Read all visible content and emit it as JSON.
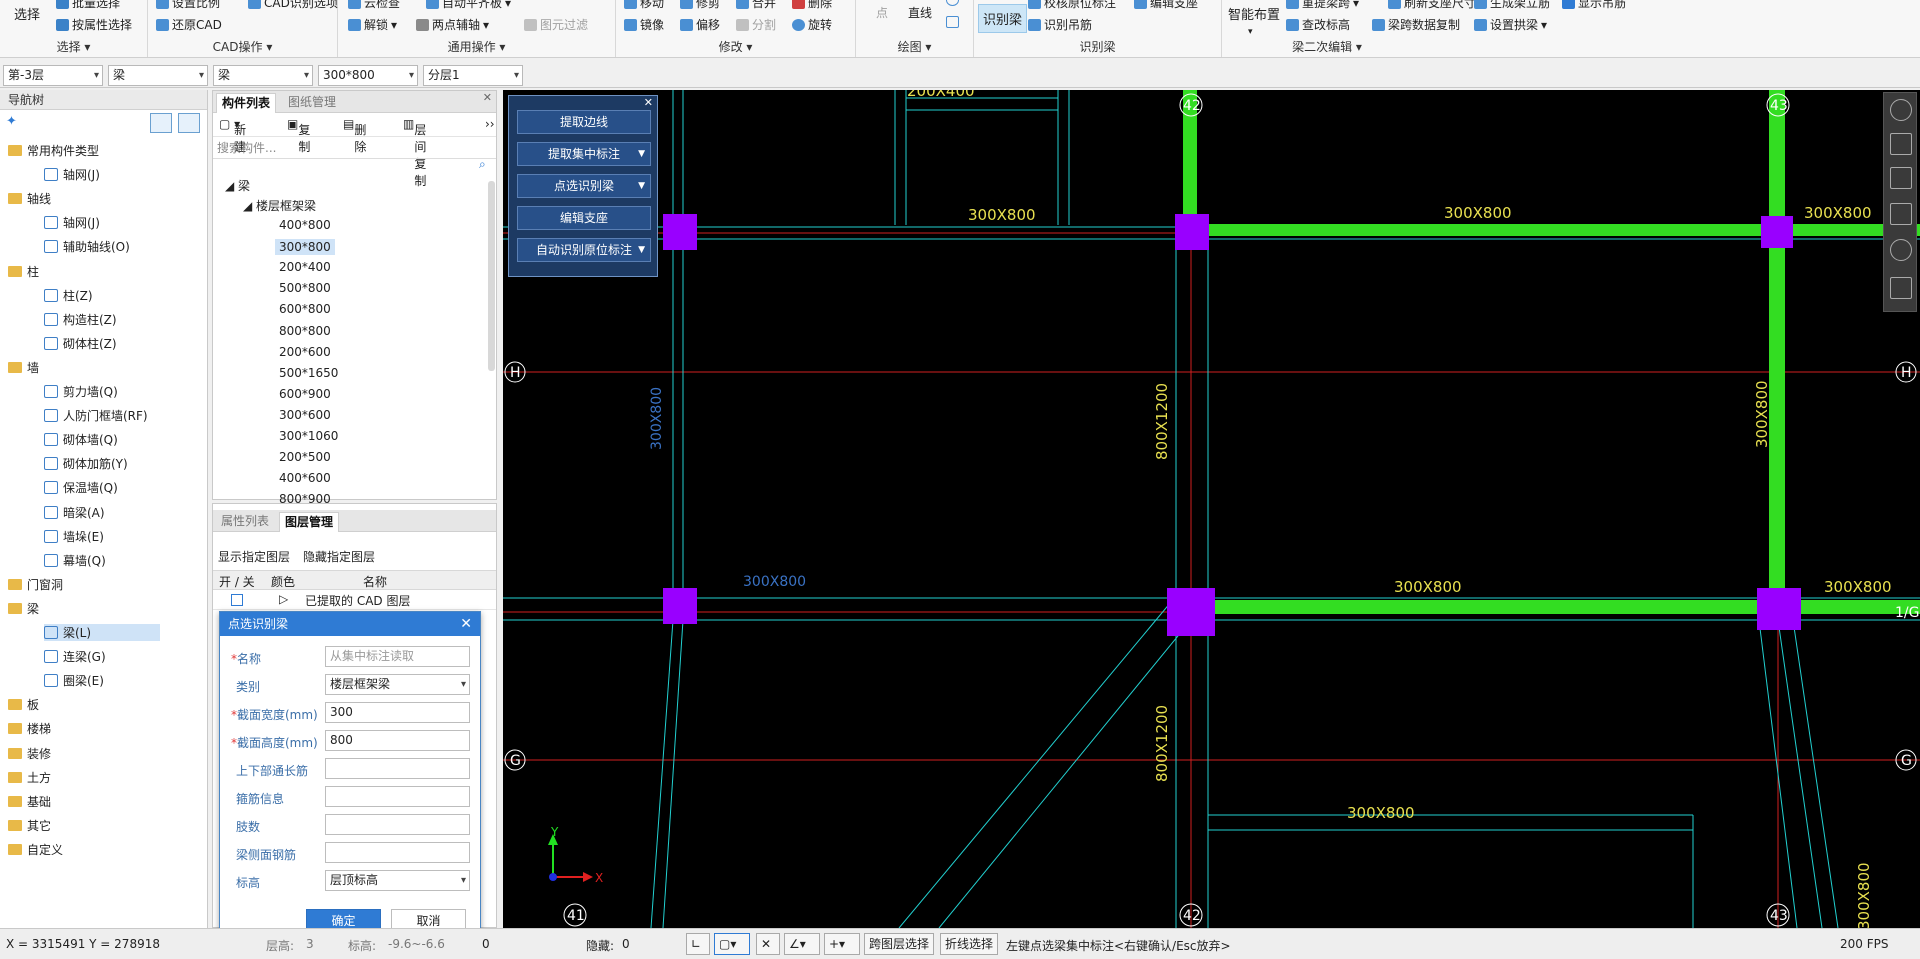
{
  "ribbon": {
    "groups": [
      {
        "id": "select",
        "title": "选择",
        "items": [
          "选择",
          "批量选择",
          "按属性选择"
        ]
      },
      {
        "id": "cad",
        "title": "CAD操作",
        "items": [
          "设置比例",
          "CAD识别选项",
          "还原CAD"
        ]
      },
      {
        "id": "common",
        "title": "通用操作",
        "items": [
          "云检查",
          "自动平齐板",
          "解锁",
          "两点辅轴",
          "图元过滤"
        ]
      },
      {
        "id": "modify",
        "title": "修改",
        "items": [
          "移动",
          "修剪",
          "合并",
          "删除",
          "镜像",
          "偏移",
          "分割",
          "旋转"
        ]
      },
      {
        "id": "draw",
        "title": "绘图",
        "items": [
          "点",
          "直线"
        ]
      },
      {
        "id": "recog",
        "title": "识别梁",
        "items": [
          "识别梁",
          "校核原位标注",
          "编辑支座",
          "识别吊筋"
        ]
      },
      {
        "id": "beam2",
        "title": "梁二次编辑",
        "items": [
          "智能布置",
          "重提梁跨",
          "刷新支座尺寸",
          "生成架立筋",
          "显示吊筋",
          "查改标高",
          "梁跨数据复制",
          "设置拱梁"
        ]
      }
    ]
  },
  "selectors": {
    "floor": "第-3层",
    "type": "梁",
    "subtype": "梁",
    "size": "300*800",
    "layer": "分层1"
  },
  "nav": {
    "title": "导航树",
    "tree": [
      {
        "label": "常用构件类型",
        "kind": "folder"
      },
      {
        "label": "轴网(J)",
        "kind": "leaf"
      },
      {
        "label": "轴线",
        "kind": "folder"
      },
      {
        "label": "轴网(J)",
        "kind": "leaf"
      },
      {
        "label": "辅助轴线(O)",
        "kind": "leaf"
      },
      {
        "label": "柱",
        "kind": "folder"
      },
      {
        "label": "柱(Z)",
        "kind": "leaf"
      },
      {
        "label": "构造柱(Z)",
        "kind": "leaf"
      },
      {
        "label": "砌体柱(Z)",
        "kind": "leaf"
      },
      {
        "label": "墙",
        "kind": "folder"
      },
      {
        "label": "剪力墙(Q)",
        "kind": "leaf"
      },
      {
        "label": "人防门框墙(RF)",
        "kind": "leaf"
      },
      {
        "label": "砌体墙(Q)",
        "kind": "leaf"
      },
      {
        "label": "砌体加筋(Y)",
        "kind": "leaf"
      },
      {
        "label": "保温墙(Q)",
        "kind": "leaf"
      },
      {
        "label": "暗梁(A)",
        "kind": "leaf"
      },
      {
        "label": "墙垛(E)",
        "kind": "leaf"
      },
      {
        "label": "幕墙(Q)",
        "kind": "leaf"
      },
      {
        "label": "门窗洞",
        "kind": "folder"
      },
      {
        "label": "梁",
        "kind": "folder"
      },
      {
        "label": "梁(L)",
        "kind": "leaf",
        "selected": true
      },
      {
        "label": "连梁(G)",
        "kind": "leaf"
      },
      {
        "label": "圈梁(E)",
        "kind": "leaf"
      },
      {
        "label": "板",
        "kind": "folder"
      },
      {
        "label": "楼梯",
        "kind": "folder"
      },
      {
        "label": "装修",
        "kind": "folder"
      },
      {
        "label": "土方",
        "kind": "folder"
      },
      {
        "label": "基础",
        "kind": "folder"
      },
      {
        "label": "其它",
        "kind": "folder"
      },
      {
        "label": "自定义",
        "kind": "folder"
      }
    ]
  },
  "complist": {
    "tabs": [
      "构件列表",
      "图纸管理"
    ],
    "tools": [
      "新建",
      "复制",
      "删除",
      "层间复制"
    ],
    "search_placeholder": "搜索构件...",
    "root": "梁",
    "group": "楼层框架梁",
    "items": [
      "400*800",
      "300*800",
      "200*400",
      "500*800",
      "600*800",
      "800*800",
      "200*600",
      "500*1650",
      "600*900",
      "300*600",
      "300*1060",
      "200*500",
      "400*600",
      "800*900"
    ],
    "selected": "300*800"
  },
  "layerpanel": {
    "tabs": [
      "属性列表",
      "图层管理"
    ],
    "buttons": [
      "显示指定图层",
      "隐藏指定图层"
    ],
    "headers": [
      "开 / 关",
      "颜色",
      "名称"
    ],
    "rows": [
      {
        "name": "已提取的 CAD 图层"
      }
    ]
  },
  "dialog": {
    "title": "点选识别梁",
    "fields": [
      {
        "label": "名称",
        "required": true,
        "value": "",
        "placeholder": "从集中标注读取",
        "type": "text"
      },
      {
        "label": "类别",
        "required": false,
        "value": "楼层框架梁",
        "type": "select"
      },
      {
        "label": "截面宽度(mm)",
        "required": true,
        "value": "300",
        "type": "text"
      },
      {
        "label": "截面高度(mm)",
        "required": true,
        "value": "800",
        "type": "text"
      },
      {
        "label": "上下部通长筋",
        "required": false,
        "value": "",
        "type": "text"
      },
      {
        "label": "箍筋信息",
        "required": false,
        "value": "",
        "type": "text"
      },
      {
        "label": "肢数",
        "required": false,
        "value": "",
        "type": "text"
      },
      {
        "label": "梁侧面钢筋",
        "required": false,
        "value": "",
        "type": "text"
      },
      {
        "label": "标高",
        "required": false,
        "value": "层顶标高",
        "type": "select"
      }
    ],
    "ok": "确定",
    "cancel": "取消"
  },
  "recog": {
    "buttons": [
      {
        "label": "提取边线",
        "dropdown": false
      },
      {
        "label": "提取集中标注",
        "dropdown": true
      },
      {
        "label": "点选识别梁",
        "dropdown": true
      },
      {
        "label": "编辑支座",
        "dropdown": false
      },
      {
        "label": "自动识别原位标注",
        "dropdown": true
      }
    ]
  },
  "canvas": {
    "axis_labels": {
      "a42": "42",
      "a43": "43",
      "a41": "41",
      "H": "H",
      "G": "G",
      "G1": "1/G"
    },
    "beam_labels": [
      "300X800",
      "300X800",
      "300X800",
      "300X800",
      "300X800",
      "300X800",
      "300X800",
      "300X800",
      "800X1200",
      "800X1200",
      "300X800",
      "200X400",
      "300X800"
    ],
    "colors": {
      "beam": "#33dd22",
      "column": "#9900ff",
      "line": "#22d0d0",
      "axis": "#d02020",
      "text": "#e8e050"
    }
  },
  "status": {
    "coords": "X = 3315491 Y = 278918",
    "floor_label": "层高:",
    "floor_val": "3",
    "elev_label": "标高:",
    "elev_val": "-9.6~-6.6",
    "zero": "0",
    "hidden_label": "隐藏:",
    "hidden_val": "0",
    "cross_floor": "跨图层选择",
    "polyline": "折线选择",
    "hint": "左键点选梁集中标注<右键确认/Esc放弃>",
    "fps": "200 FPS"
  }
}
